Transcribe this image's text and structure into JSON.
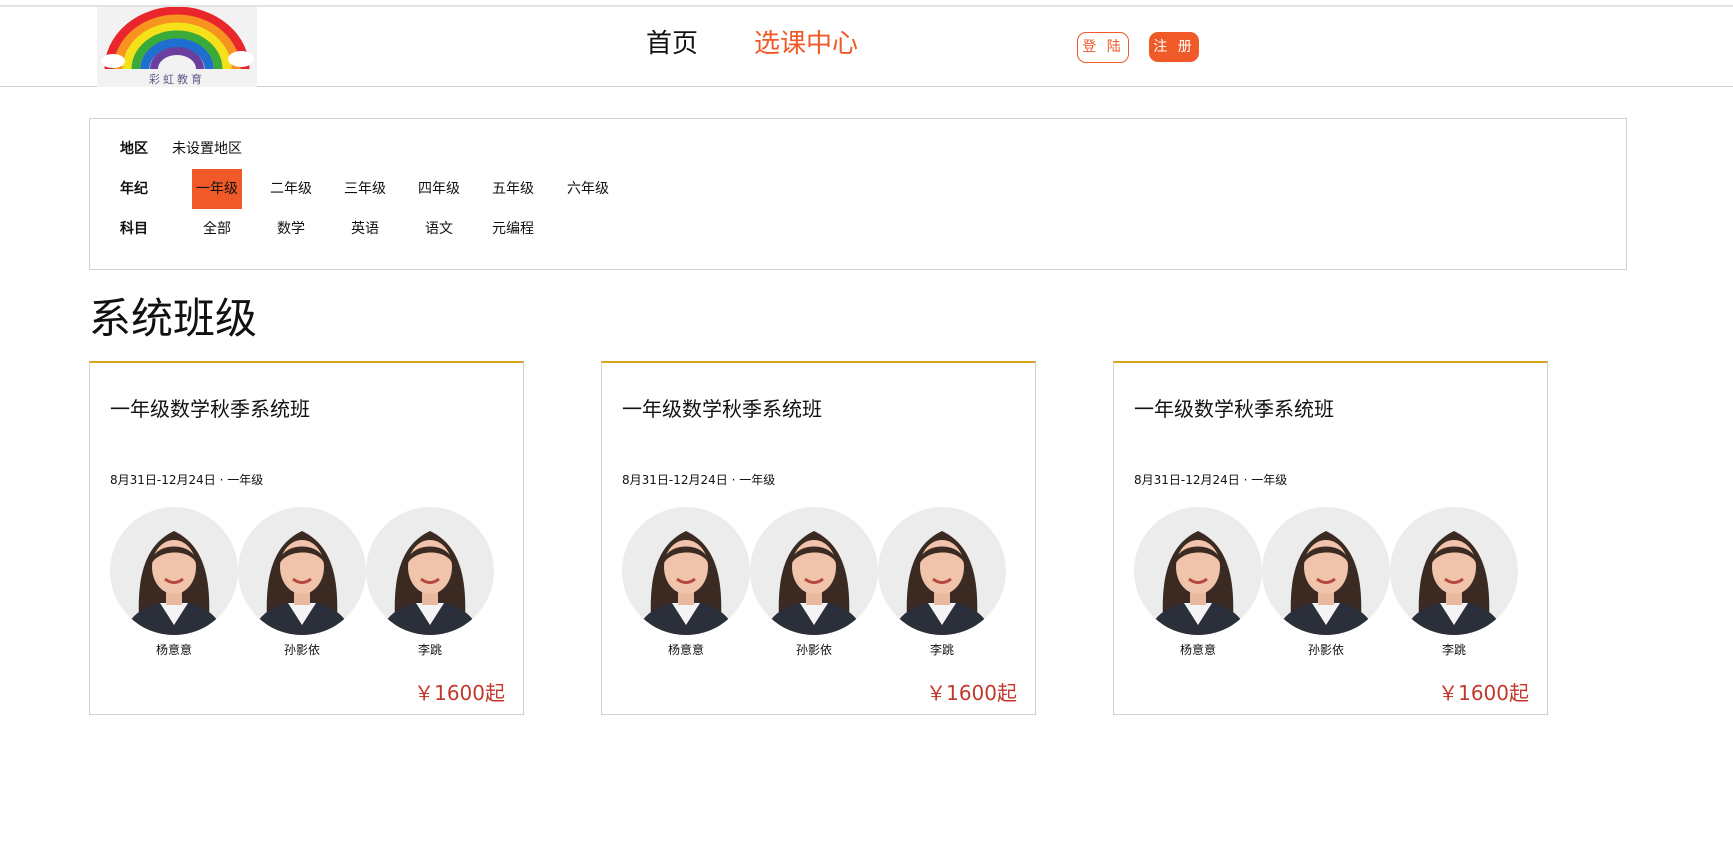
{
  "header": {
    "logo_text": "彩虹教育",
    "nav": [
      {
        "label": "首页"
      },
      {
        "label": "选课中心"
      }
    ],
    "login_label": "登 陆",
    "register_label": "注 册"
  },
  "filters": {
    "region": {
      "label": "地区",
      "value": "未设置地区"
    },
    "grade": {
      "label": "年纪",
      "options": [
        "一年级",
        "二年级",
        "三年级",
        "四年级",
        "五年级",
        "六年级"
      ],
      "selected": "一年级"
    },
    "subject": {
      "label": "科目",
      "options": [
        "全部",
        "数学",
        "英语",
        "语文",
        "元编程"
      ]
    }
  },
  "section_title": "系统班级",
  "cards": [
    {
      "title": "一年级数学秋季系统班",
      "meta": "8月31日-12月24日 · 一年级",
      "teachers": [
        "杨意意",
        "孙影依",
        "李跳"
      ],
      "price": "￥1600起"
    },
    {
      "title": "一年级数学秋季系统班",
      "meta": "8月31日-12月24日 · 一年级",
      "teachers": [
        "杨意意",
        "孙影依",
        "李跳"
      ],
      "price": "￥1600起"
    },
    {
      "title": "一年级数学秋季系统班",
      "meta": "8月31日-12月24日 · 一年级",
      "teachers": [
        "杨意意",
        "孙影依",
        "李跳"
      ],
      "price": "￥1600起"
    }
  ],
  "colors": {
    "accent": "#f05a28",
    "card_top_border": "#d9a521",
    "price": "#c0392b"
  }
}
